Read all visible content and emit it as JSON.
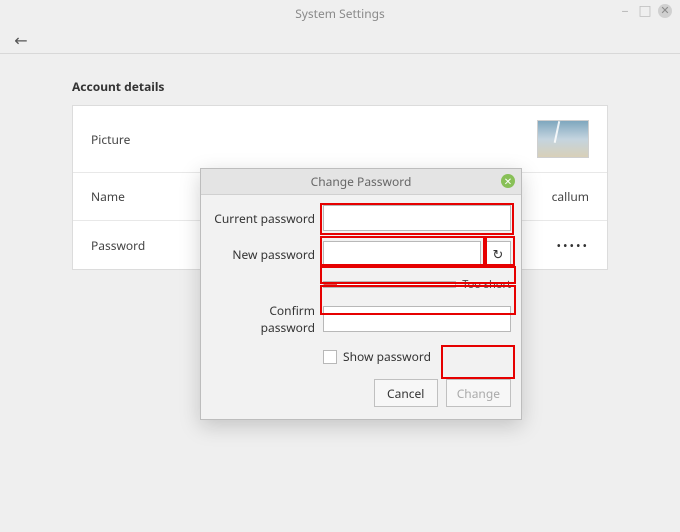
{
  "window": {
    "title": "System Settings"
  },
  "section": {
    "title": "Account details"
  },
  "rows": {
    "picture_label": "Picture",
    "name_label": "Name",
    "name_value": "callum",
    "password_label": "Password",
    "password_value": "•••••"
  },
  "dialog": {
    "title": "Change Password",
    "current_label": "Current password",
    "new_label": "New password",
    "confirm_label": "Confirm password",
    "strength_text": "Too short",
    "show_password_label": "Show password",
    "cancel": "Cancel",
    "change": "Change",
    "current_value": "",
    "new_value": "",
    "confirm_value": ""
  },
  "colors": {
    "highlight": "#e60000"
  }
}
